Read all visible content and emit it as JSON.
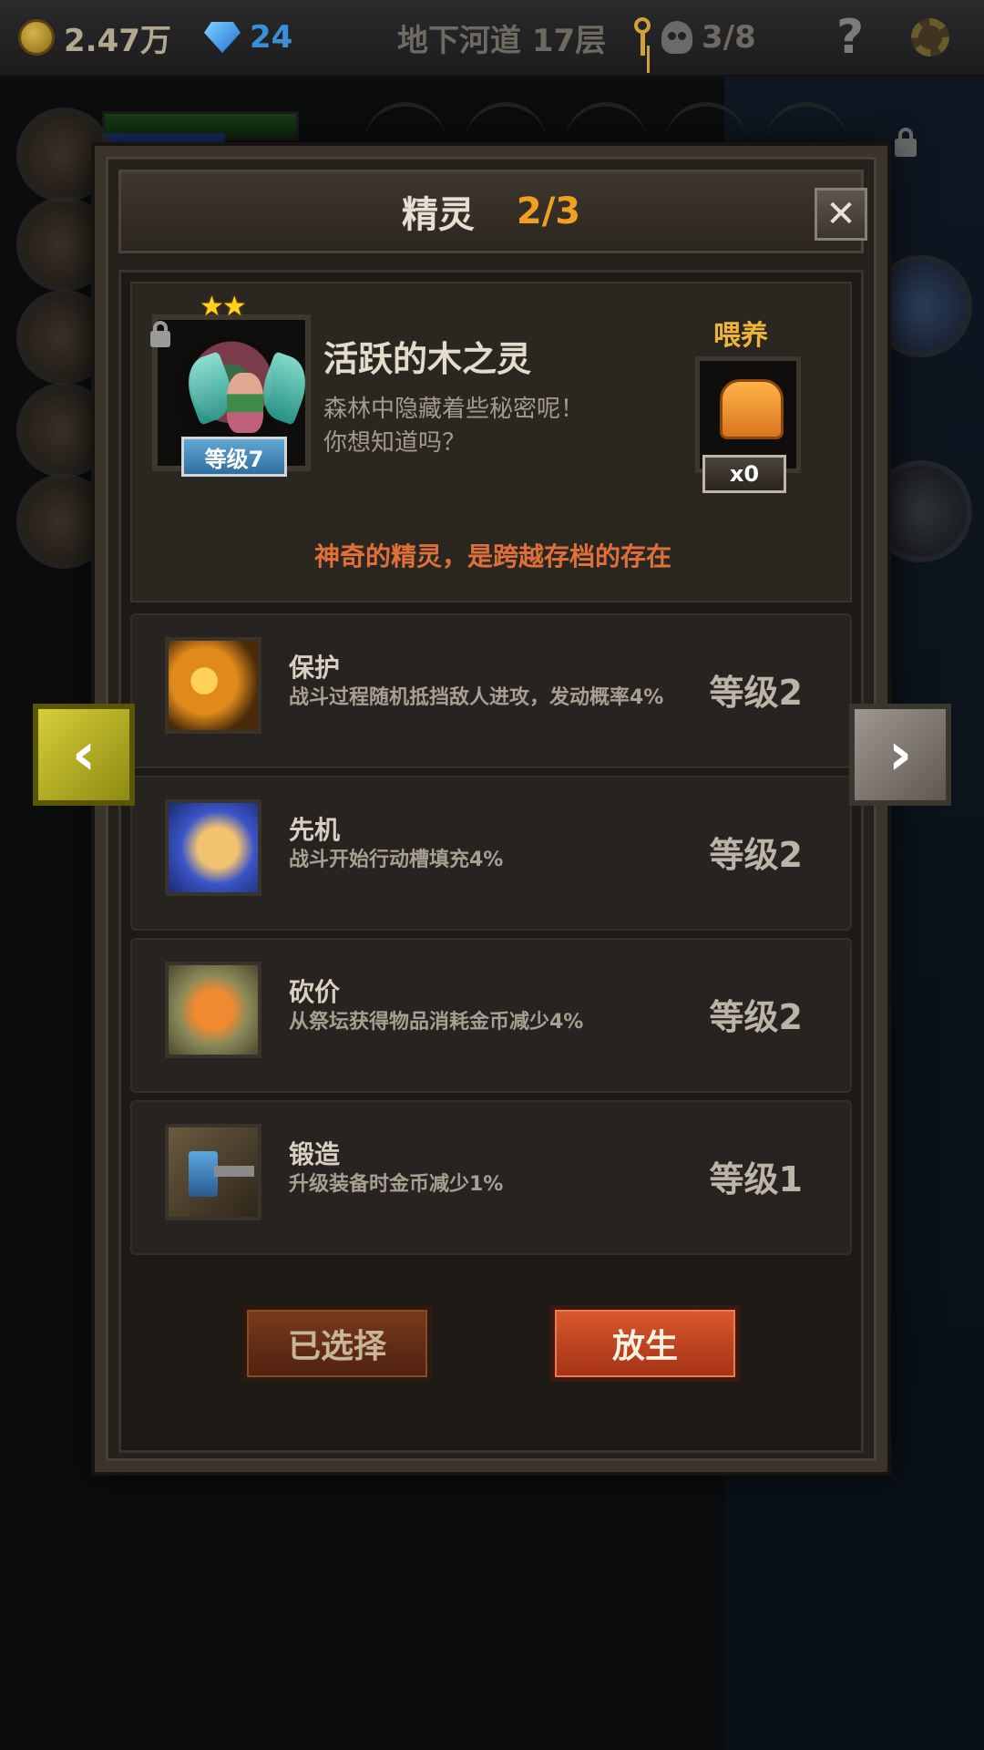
{
  "topbar": {
    "gold": "2.47万",
    "gems": "24",
    "location": "地下河道 17层",
    "kills": "3/8",
    "help": "?",
    "icons": [
      "coin-icon",
      "gem-icon",
      "key-icon",
      "skull-icon",
      "help-icon",
      "gear-icon"
    ]
  },
  "modal": {
    "title": "精灵",
    "page": "2/3",
    "close": "✕"
  },
  "spirit": {
    "stars": "★★",
    "level": "等级7",
    "name": "活跃的木之灵",
    "description": "森林中隐藏着些秘密呢！\n你想知道吗？",
    "feed_label": "喂养",
    "feed_count": "x0",
    "note": "神奇的精灵，是跨越存档的存在"
  },
  "skills": [
    {
      "name": "保护",
      "desc": "战斗过程随机抵挡敌人进攻，发动概率4%",
      "level": "等级2",
      "icon": "protect-icon"
    },
    {
      "name": "先机",
      "desc": "战斗开始行动槽填充4%",
      "level": "等级2",
      "icon": "leopard-icon"
    },
    {
      "name": "砍价",
      "desc": "从祭坛获得物品消耗金币减少4%",
      "level": "等级2",
      "icon": "coin-stack-icon"
    },
    {
      "name": "锻造",
      "desc": "升级装备时金币减少1%",
      "level": "等级1",
      "icon": "hammer-icon"
    }
  ],
  "buttons": {
    "selected": "已选择",
    "release": "放生",
    "prev": "‹",
    "next": "›"
  },
  "colors": {
    "accent_orange": "#f0a020",
    "note_orange": "#e0703a",
    "level_badge_blue": "#4a8fc0",
    "release_red": "#c0441f"
  }
}
